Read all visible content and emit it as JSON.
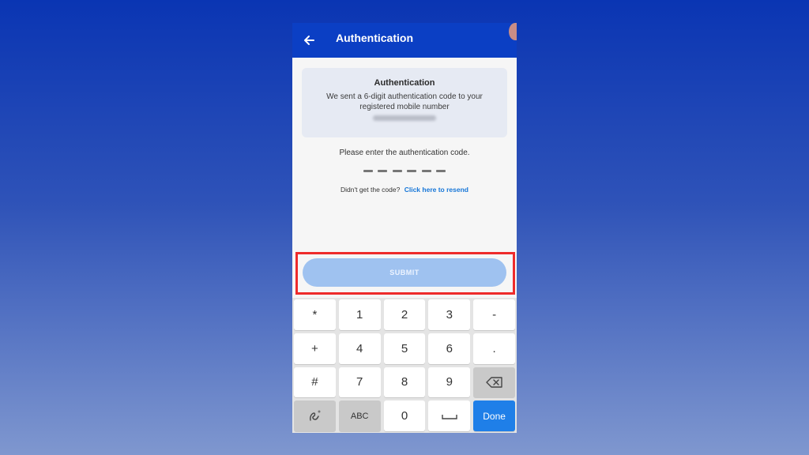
{
  "appbar": {
    "title": "Authentication",
    "back_icon": "arrow-left-icon"
  },
  "info_card": {
    "title": "Authentication",
    "message": "We sent a 6-digit authentication code to your registered mobile number"
  },
  "prompt": "Please enter the authentication code.",
  "code": {
    "length": 6
  },
  "resend": {
    "text": "Didn't get the code?",
    "link": "Click here to resend"
  },
  "submit_label": "SUBMIT",
  "keypad": {
    "keys": [
      "*",
      "1",
      "2",
      "3",
      "-",
      "+",
      "4",
      "5",
      "6",
      ".",
      "#",
      "7",
      "8",
      "9",
      "backspace",
      "handwriting",
      "ABC",
      "0",
      "space",
      "Done"
    ]
  },
  "colors": {
    "appbar": "#0b3fc4",
    "submit": "#9fc2f0",
    "link": "#1676d8",
    "highlight": "#ee2b2b",
    "done": "#1f7fe8"
  }
}
